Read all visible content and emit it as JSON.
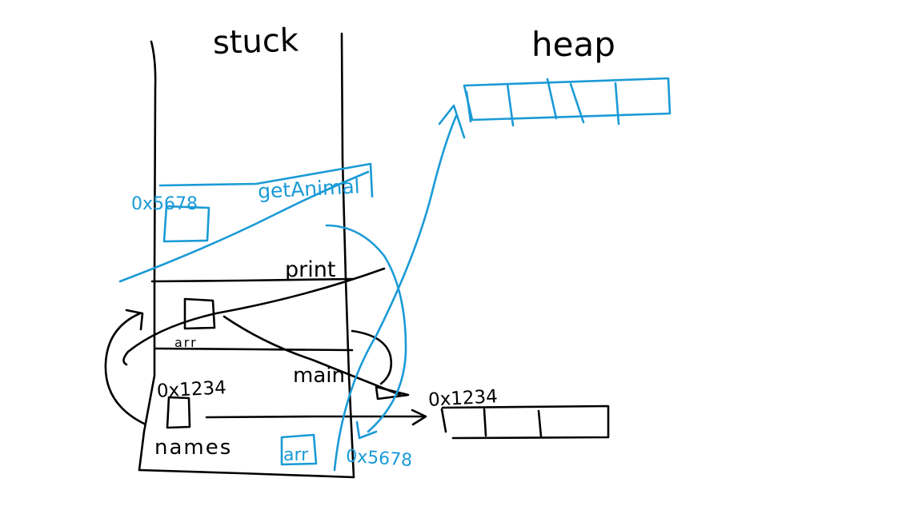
{
  "colors": {
    "ink": "#000000",
    "accent": "#1a9ad6",
    "background": "#ffffff"
  },
  "titles": {
    "stack": "stuck",
    "heap": "heap"
  },
  "frames": {
    "top": "getAnimal",
    "middle": "print",
    "bottom": "main"
  },
  "labels": {
    "names_var": "names",
    "arr_var": "arr",
    "arr_param": "arr",
    "addr_main": "0x1234",
    "addr_array": "0x1234",
    "addr_blue_top": "0x5678",
    "addr_blue_bottom": "0x5678"
  }
}
